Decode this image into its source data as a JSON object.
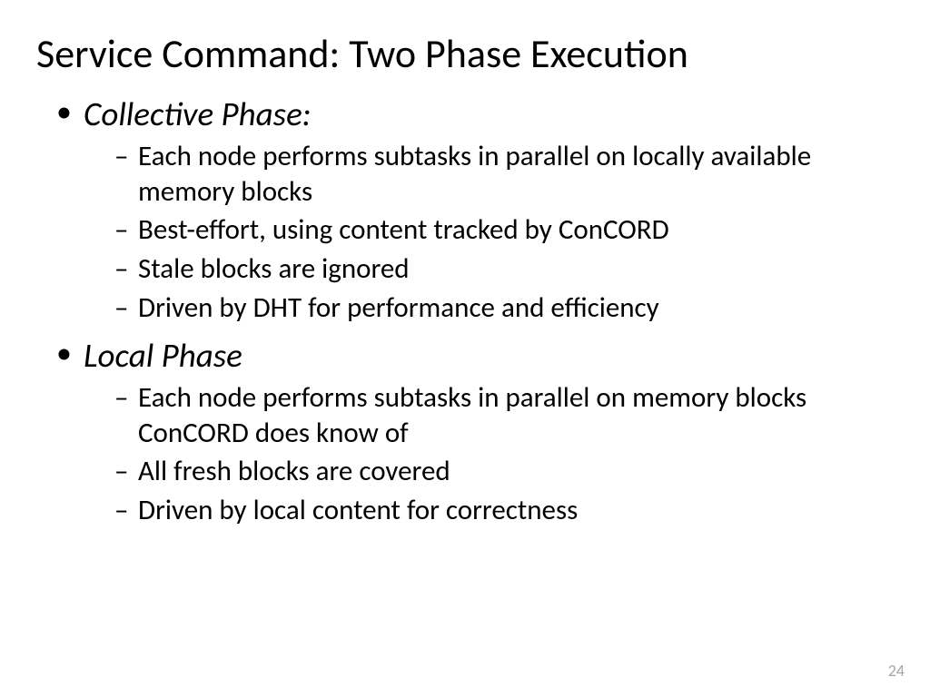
{
  "title": "Service Command: Two Phase Execution",
  "sections": [
    {
      "heading": "Collective Phase:",
      "items": [
        "Each node performs subtasks in parallel on locally available memory blocks",
        "Best-effort, using content tracked by ConCORD",
        "Stale blocks are ignored",
        "Driven by DHT for performance and efficiency"
      ]
    },
    {
      "heading": "Local Phase",
      "items": [
        "Each node performs subtasks in parallel on memory blocks ConCORD does know of",
        "All fresh blocks are covered",
        "Driven by local content for correctness"
      ]
    }
  ],
  "page_number": "24"
}
